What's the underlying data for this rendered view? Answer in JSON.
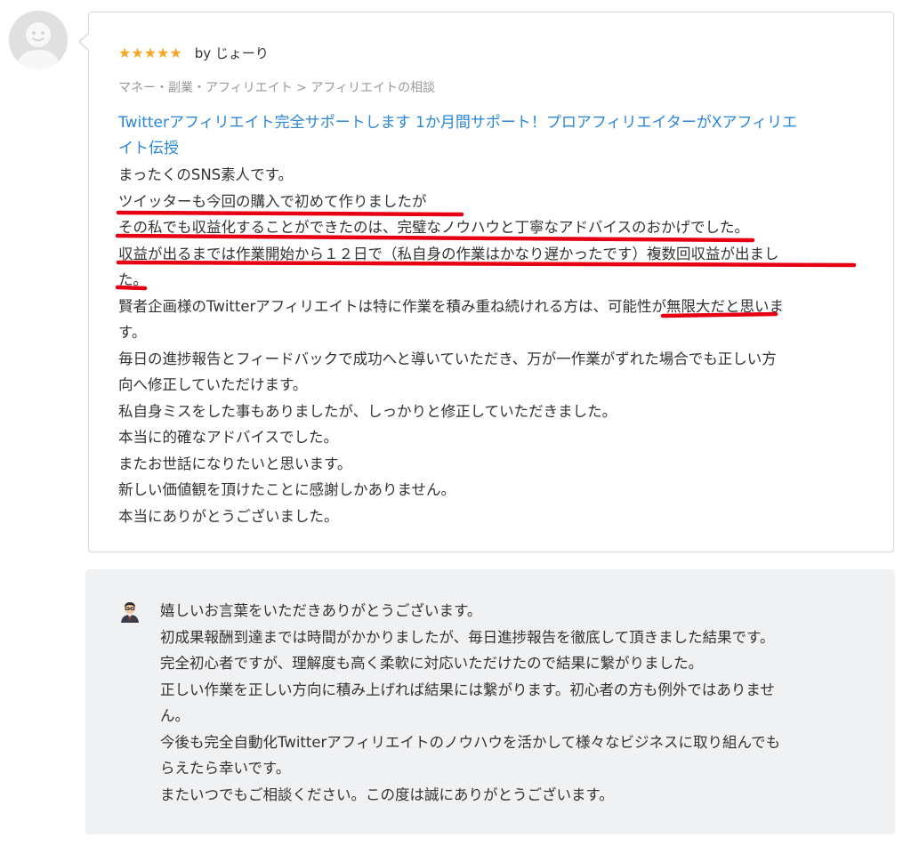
{
  "review": {
    "stars": "★★★★★",
    "rating": 5,
    "author": "by じょーり",
    "category": "マネー・副業・アフィリエイト > アフィリエイトの相談",
    "service_title_lines": [
      "Twitterアフィリエイト完全サポートします 1か月間サポート！プロアフィリエイターがXアフィリエ",
      "イト伝授"
    ],
    "body_lines": [
      "まったくのSNS素人です。",
      "ツイッターも今回の購入で初めて作りましたが",
      "その私でも収益化することができたのは、完璧なノウハウと丁寧なアドバイスのおかげでした。",
      "収益が出るまでは作業開始から１２日で（私自身の作業はかなり遅かったです）複数回収益が出まし",
      "た。",
      "賢者企画様のTwitterアフィリエイトは特に作業を積み重ね続けれる方は、可能性が無限大だと思いま",
      "す。",
      "毎日の進捗報告とフィードバックで成功へと導いていただき、万が一作業がずれた場合でも正しい方",
      "向へ修正していただけます。",
      "私自身ミスをした事もありましたが、しっかりと修正していただきました。",
      "本当に的確なアドバイスでした。",
      "またお世話になりたいと思います。",
      "新しい価値観を頂けたことに感謝しかありません。",
      "本当にありがとうございました。"
    ],
    "underline_color": "#e60012"
  },
  "reply": {
    "body_lines": [
      "嬉しいお言葉をいただきありがとうございます。",
      "初成果報酬到達までは時間がかかりましたが、毎日進捗報告を徹底して頂きました結果です。",
      "完全初心者ですが、理解度も高く柔軟に対応いただけたので結果に繋がりました。",
      "正しい作業を正しい方向に積み上げれば結果には繋がります。初心者の方も例外ではありませ",
      "ん。",
      "今後も完全自動化Twitterアフィリエイトのノウハウを活かして様々なビジネスに取り組んでも",
      "らえたら幸いです。",
      "またいつでもご相談ください。この度は誠にありがとうございます。"
    ]
  },
  "colors": {
    "link": "#2a86d8",
    "star": "#f5a623",
    "reply_bg": "#f0f1f3",
    "border": "#d6d6d6"
  },
  "icons": {
    "reviewer_avatar": "default-user-avatar-icon",
    "seller_avatar": "seller-avatar-icon"
  }
}
